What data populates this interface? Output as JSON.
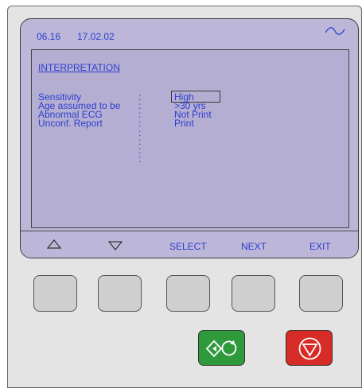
{
  "status": {
    "time": "06.16",
    "date": "17.02.02",
    "mains_icon": "ac-wave-icon"
  },
  "screen": {
    "heading": "INTERPRETATION",
    "params": [
      {
        "label": "Sensitivity",
        "value": "High",
        "selected": true
      },
      {
        "label": "Age assumed to be",
        "value": ">30 yrs",
        "selected": false
      },
      {
        "label": "Abnormal ECG",
        "value": "Not Print",
        "selected": false
      },
      {
        "label": "Unconf. Report",
        "value": "Print",
        "selected": false
      }
    ],
    "separator": ":",
    "trailing_dots": ":\n:\n:\n:"
  },
  "softkeys": {
    "up_icon": "triangle-up-icon",
    "down_icon": "triangle-down-icon",
    "select": "SELECT",
    "next": "NEXT",
    "exit": "EXIT"
  },
  "buttons": {
    "start_icon": "start-record-icon",
    "stop_icon": "stop-icon",
    "start_color": "#2f9a3c",
    "stop_color": "#d62b26"
  },
  "colors": {
    "text": "#2c3ecf",
    "screen_bg": "#b4aed2"
  }
}
